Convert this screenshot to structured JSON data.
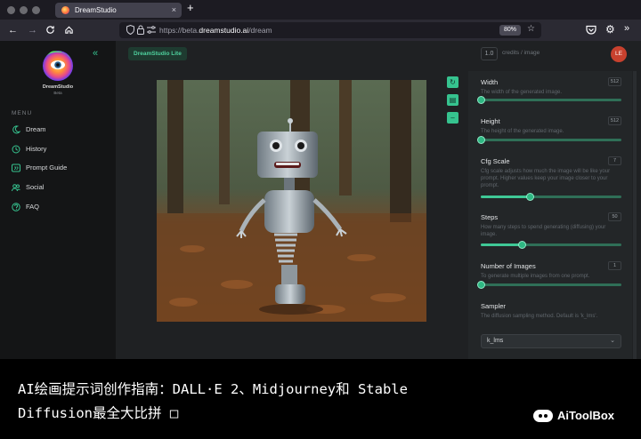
{
  "browser": {
    "tab_title": "DreamStudio",
    "tab_close": "×",
    "new_tab": "+",
    "url_prefix": "https://beta.",
    "url_domain": "dreamstudio.ai",
    "url_path": "/dream",
    "zoom": "80%"
  },
  "sidebar": {
    "brand": "DreamStudio",
    "brand_sub": "Beta",
    "collapse": "«",
    "menu_heading": "MENU",
    "items": [
      {
        "label": "Dream"
      },
      {
        "label": "History"
      },
      {
        "label": "Prompt Guide"
      },
      {
        "label": "Social"
      },
      {
        "label": "FAQ"
      }
    ]
  },
  "topbar": {
    "pill": "DreamStudio Lite",
    "credits_value": "1.0",
    "credits_label": "credits / image",
    "avatar_initials": "LE"
  },
  "settings": {
    "width": {
      "label": "Width",
      "desc": "The width of the generated image.",
      "value": "512",
      "fraction": 0.0
    },
    "height": {
      "label": "Height",
      "desc": "The height of the generated image.",
      "value": "512",
      "fraction": 0.0
    },
    "cfg": {
      "label": "Cfg Scale",
      "desc": "Cfg scale adjusts how much the image will be like your prompt. Higher values keep your image closer to your prompt.",
      "value": "7",
      "fraction": 0.35
    },
    "steps": {
      "label": "Steps",
      "desc": "How many steps to spend generating (diffusing) your image.",
      "value": "50",
      "fraction": 0.29
    },
    "num_images": {
      "label": "Number of Images",
      "desc": "To generate multiple images from one prompt.",
      "value": "1",
      "fraction": 0.0
    },
    "sampler": {
      "label": "Sampler",
      "desc": "The diffusion sampling method. Default is 'k_lms'.",
      "selected": "k_lms"
    }
  },
  "caption": {
    "text": "AI绘画提示词创作指南：DALL·E 2、Midjourney和 Stable Diffusion最全大比拼 □",
    "brand": "AiToolBox"
  },
  "colors": {
    "accent": "#36c38f",
    "app_bg": "#1f2123",
    "sidebar_bg": "#141516",
    "avatar": "#c8412e"
  }
}
